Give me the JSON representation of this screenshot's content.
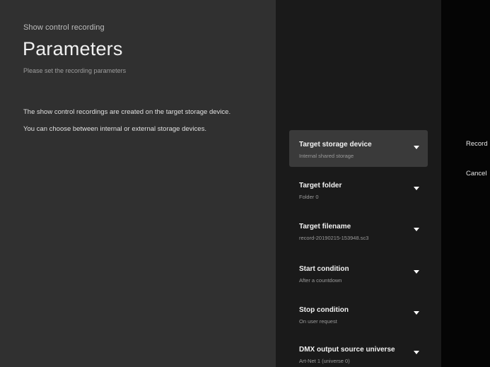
{
  "guidance": {
    "breadcrumb": "Show control recording",
    "title": "Parameters",
    "subtitle": "Please set the recording parameters",
    "description_line_1": "The show control recordings are created on the target storage device.",
    "description_line_2": "You can choose between internal or external storage devices."
  },
  "parameters": [
    {
      "title": "Target storage device",
      "value": "Internal shared storage",
      "focused": true
    },
    {
      "title": "Target folder",
      "value": "Folder 0",
      "focused": false
    },
    {
      "title": "Target filename",
      "value": "record-20190215-153948.sc3",
      "focused": false
    },
    {
      "title": "Start condition",
      "value": "After a countdown",
      "focused": false
    },
    {
      "title": "Stop condition",
      "value": "On user request",
      "focused": false
    },
    {
      "title": "DMX output source universe",
      "value": "Art-Net 1 (universe 0)",
      "focused": false
    }
  ],
  "actions": {
    "record_label": "Record",
    "cancel_label": "Cancel"
  },
  "colors": {
    "guidance_background": "#303030",
    "list_background": "#1a1a1a",
    "focused_item_background": "#3a3a3a",
    "actions_background": "#050505"
  }
}
